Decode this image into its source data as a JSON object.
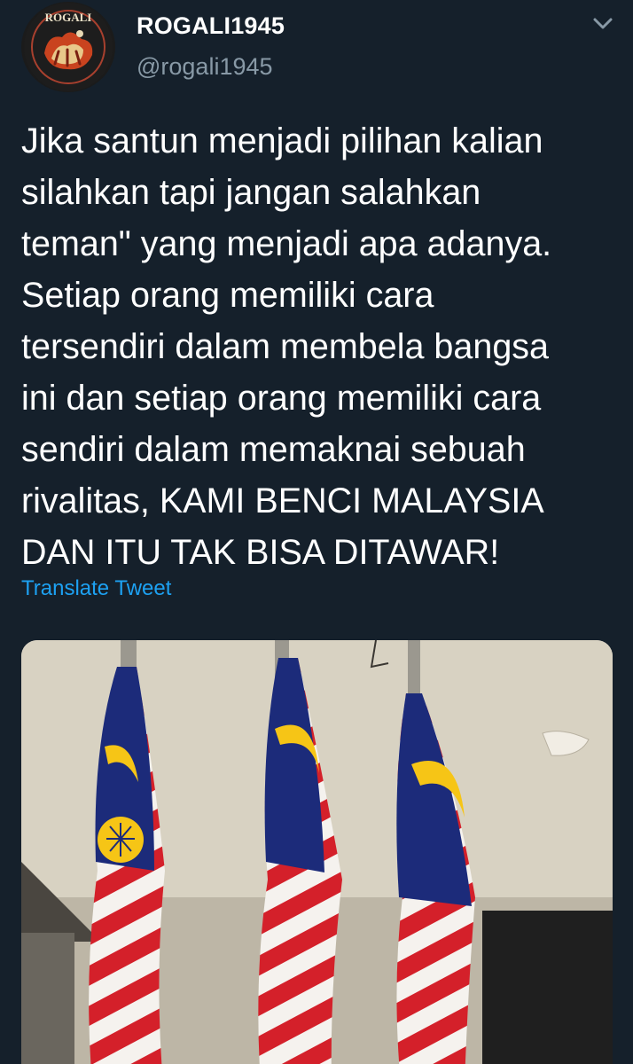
{
  "tweet": {
    "display_name": "ROGALI1945",
    "handle": "@rogali1945",
    "text_lines": [
      "Jika santun menjadi pilihan kalian",
      "silahkan tapi jangan salahkan",
      "teman\" yang menjadi apa adanya.",
      "Setiap orang memiliki cara",
      "tersendiri dalam membela bangsa",
      "ini dan setiap orang memiliki cara",
      "sendiri dalam memaknai sebuah",
      "rivalitas, KAMI BENCI MALAYSIA",
      "DAN ITU TAK BISA DITAWAR!"
    ],
    "translate_label": "Translate Tweet"
  },
  "avatar": {
    "logo_text": "ROGALI"
  },
  "icons": {
    "menu": "chevron-down-icon",
    "avatar": "rogali-logo"
  },
  "colors": {
    "background": "#15202b",
    "text": "#ffffff",
    "secondary_text": "#8899a6",
    "link": "#1da1f2"
  }
}
